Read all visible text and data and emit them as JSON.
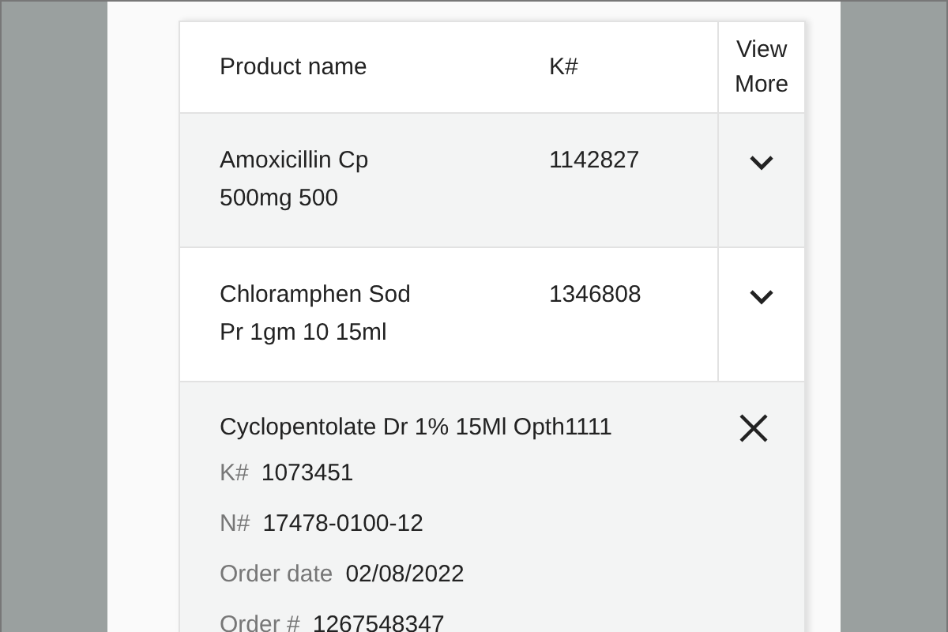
{
  "table": {
    "columns": [
      "Product name",
      "K#",
      "View\nMore"
    ],
    "rows": [
      {
        "product_name": "Amoxicillin Cp\n500mg 500",
        "k_number": "1142827",
        "expanded": false,
        "shaded": true
      },
      {
        "product_name": "Chloramphen Sod\nPr 1gm 10 15ml",
        "k_number": "1346808",
        "expanded": false,
        "shaded": false
      },
      {
        "product_name": "Cyclopentolate Dr 1% 15Ml Opth1111",
        "expanded": true,
        "shaded": true,
        "details": [
          {
            "label": "K#",
            "value": "1073451"
          },
          {
            "label": "N#",
            "value": "17478-0100-12"
          },
          {
            "label": "Order date",
            "value": "02/08/2022"
          },
          {
            "label": "Order #",
            "value": "1267548347"
          }
        ]
      }
    ]
  }
}
